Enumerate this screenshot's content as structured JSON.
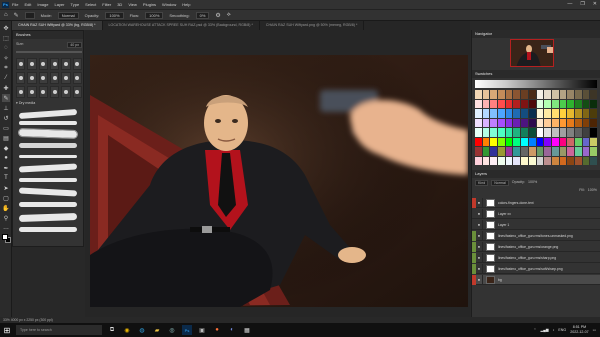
{
  "menubar": {
    "logo": "Ps",
    "items": [
      "File",
      "Edit",
      "Image",
      "Layer",
      "Type",
      "Select",
      "Filter",
      "3D",
      "View",
      "Plugins",
      "Window",
      "Help"
    ],
    "window_buttons": [
      "—",
      "❐",
      "✕"
    ]
  },
  "optbar": {
    "mode_label": "Mode:",
    "mode_value": "Normal",
    "opacity_label": "Opacity:",
    "opacity_value": "100%",
    "flow_label": "Flow:",
    "flow_value": "100%",
    "smoothing_label": "Smoothing:",
    "smoothing_value": "0%"
  },
  "tabs": [
    {
      "label": "CHAIN RAZ SUH Wiftyard @ 33% (bg, RGB/8) *",
      "active": true
    },
    {
      "label": "LOCATION WAREHOUSE ATTACK SPREE SUH RAZ.psd @ 33% (Background, RGB/8) *",
      "active": false
    },
    {
      "label": "CHAIN RAZ SUH Wiftyard.png @ 50% (meneg, RGB/8) *",
      "active": false
    }
  ],
  "brushes": {
    "title": "Brushes",
    "size_label": "Size:",
    "size_value": "40 px",
    "folder_label": "Dry media"
  },
  "navigator": {
    "title": "Navigator",
    "zoom": "33.33%"
  },
  "swatches": {
    "title": "Swatches",
    "colors": [
      "#f2d7b5",
      "#e8c39a",
      "#d9a877",
      "#c48c5a",
      "#a86f42",
      "#8a5532",
      "#6a3e22",
      "#4a2a16",
      "#f5f0e6",
      "#e6dccb",
      "#cfc1a6",
      "#b3a384",
      "#978566",
      "#786a4d",
      "#5a4f38",
      "#3d3526",
      "#ffe0e0",
      "#ffb3b3",
      "#ff8080",
      "#ff4d4d",
      "#e62e2e",
      "#b31f1f",
      "#801414",
      "#4d0b0b",
      "#e0ffe0",
      "#b3ffb3",
      "#80e680",
      "#4dcc4d",
      "#2eb32e",
      "#1f801f",
      "#144d14",
      "#0b2e0b",
      "#e0f0ff",
      "#b3d9ff",
      "#80bfff",
      "#4da6ff",
      "#2e8ae6",
      "#1f6bb3",
      "#144d80",
      "#0b2e4d",
      "#fff7d6",
      "#ffeaa3",
      "#ffdd70",
      "#ffd03d",
      "#e6b82e",
      "#b38f1f",
      "#806614",
      "#4d3d0b",
      "#f0e0ff",
      "#d9b3ff",
      "#bf80ff",
      "#a64dff",
      "#8a2ee6",
      "#6b1fb3",
      "#4d1480",
      "#2e0b4d",
      "#ffe6cc",
      "#ffcc99",
      "#ffb366",
      "#ff9933",
      "#e67a1a",
      "#b35c0f",
      "#803f08",
      "#4d2504",
      "#e6fff7",
      "#b3ffe6",
      "#80ffd4",
      "#4dffc2",
      "#2ee6a6",
      "#1fb380",
      "#14805c",
      "#0b4d38",
      "#ffffff",
      "#e0e0e0",
      "#c0c0c0",
      "#a0a0a0",
      "#808080",
      "#606060",
      "#404040",
      "#000000",
      "#ff0000",
      "#ff8000",
      "#ffff00",
      "#80ff00",
      "#00ff00",
      "#00ff80",
      "#00ffff",
      "#0080ff",
      "#0000ff",
      "#8000ff",
      "#ff00ff",
      "#ff0080",
      "#cc6666",
      "#66cc66",
      "#6666cc",
      "#cccc66",
      "#993333",
      "#339933",
      "#333399",
      "#999933",
      "#993399",
      "#339999",
      "#666666",
      "#cc9966",
      "#669966",
      "#996699",
      "#669999",
      "#999966",
      "#cc6699",
      "#66cc99",
      "#9966cc",
      "#99cc66",
      "#ffd1dc",
      "#ffe4e1",
      "#fff0f5",
      "#f0fff0",
      "#f0f8ff",
      "#e6e6fa",
      "#fffacd",
      "#fafad2",
      "#d3d3d3",
      "#bc8f8f",
      "#cd853f",
      "#d2691e",
      "#8b4513",
      "#a0522d",
      "#556b2f",
      "#2f4f4f"
    ]
  },
  "layers": {
    "title": "Layers",
    "kind_label": "Kind",
    "blend_value": "Normal",
    "opacity_label": "Opacity:",
    "opacity_value": "100%",
    "fill_label": "Fill:",
    "fill_value": "100%",
    "items": [
      {
        "name": "colors-fingers-done-text",
        "tag": "#c0392b",
        "eye": "●"
      },
      {
        "name": "Layer xx",
        "tag": "",
        "eye": "●"
      },
      {
        "name": "Layer 1",
        "tag": "",
        "eye": "●"
      },
      {
        "name": "lines/fastmo_office_gun.rms/tones-unmasked.png",
        "tag": "#6a8f3a",
        "eye": "●"
      },
      {
        "name": "lines/fastmo_office_gun.rms/orange.png",
        "tag": "#6a8f3a",
        "eye": "●"
      },
      {
        "name": "lines/fastmo_office_gun.rms/sharp.png",
        "tag": "#6a8f3a",
        "eye": "●"
      },
      {
        "name": "lines/fastmo_office_gun.rms/soft/sharp.png",
        "tag": "#6a8f3a",
        "eye": "●"
      },
      {
        "name": "bg",
        "tag": "#c0392b",
        "eye": "●",
        "selected": true
      }
    ]
  },
  "status": {
    "text": "33%    4000 px x 2250 px (300 ppi)"
  },
  "taskbar": {
    "search_placeholder": "Type here to search",
    "clock_time": "8:51 PM",
    "clock_date": "2022-12-07",
    "lang": "ENG"
  }
}
